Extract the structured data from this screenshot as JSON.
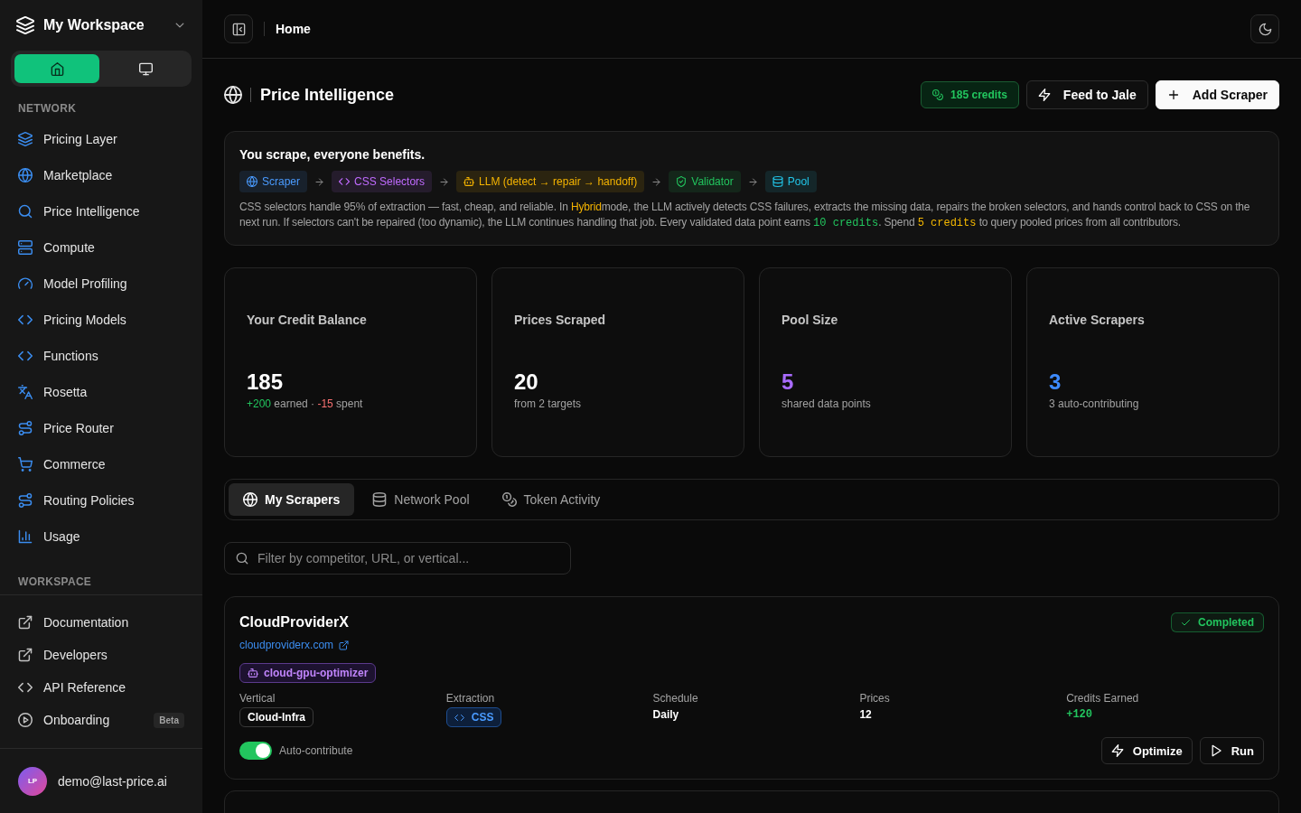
{
  "sidebar": {
    "workspace": {
      "name": "My Workspace"
    },
    "view_toggle": [
      {
        "selected": true
      },
      {
        "selected": false
      }
    ],
    "sections": [
      {
        "title": "NETWORK",
        "items": [
          {
            "label": "Pricing Layer"
          },
          {
            "label": "Marketplace"
          },
          {
            "label": "Price Intelligence"
          },
          {
            "label": "Compute"
          },
          {
            "label": "Model Profiling"
          },
          {
            "label": "Pricing Models"
          },
          {
            "label": "Functions"
          },
          {
            "label": "Rosetta"
          },
          {
            "label": "Price Router"
          },
          {
            "label": "Commerce"
          },
          {
            "label": "Routing Policies"
          },
          {
            "label": "Usage"
          }
        ]
      },
      {
        "title": "WORKSPACE",
        "items": [
          {
            "label": "Documentation"
          },
          {
            "label": "Developers"
          },
          {
            "label": "API Reference"
          },
          {
            "label": "Onboarding",
            "badge": "Beta"
          }
        ]
      }
    ],
    "user": {
      "initials": "LP",
      "email": "demo@last-price.ai"
    }
  },
  "header": {
    "breadcrumb": "Home"
  },
  "page": {
    "title": "Price Intelligence",
    "actions": [
      {
        "kind": "credits",
        "label": "185 credits"
      },
      {
        "kind": "secondary",
        "label": "Feed to Jale"
      },
      {
        "kind": "primary",
        "label": "Add Scraper"
      }
    ]
  },
  "pipeline_card": {
    "title": "You scrape, everyone benefits.",
    "steps": [
      {
        "label": "Scraper",
        "color": "#4a9bff"
      },
      {
        "label": "CSS Selectors",
        "color": "#c06bff"
      },
      {
        "label": "LLM (detect → repair → handoff)",
        "color": "#f5b400"
      },
      {
        "label": "Validator",
        "color": "#22c55e"
      },
      {
        "label": "Pool",
        "color": "#22c5e8"
      }
    ],
    "description": [
      {
        "kind": "text",
        "text": "CSS selectors handle 95% of extraction — fast, cheap, and reliable. In "
      },
      {
        "kind": "highlight",
        "text": "Hybrid",
        "color": "#f5b400"
      },
      {
        "kind": "text",
        "text": "mode, the LLM actively detects CSS failures, extracts the missing data, repairs the broken selectors, and hands control back to CSS on the next run. If selectors can't be repaired (too dynamic), the LLM continues handling that job. Every validated data point earns "
      },
      {
        "kind": "code",
        "text": "10 credits",
        "color": "#22c55e"
      },
      {
        "kind": "text",
        "text": ". Spend "
      },
      {
        "kind": "code",
        "text": "5 credits",
        "color": "#f5b800"
      },
      {
        "kind": "text",
        "text": " to query pooled prices from all contributors."
      }
    ]
  },
  "stats": [
    {
      "title": "Your Credit Balance",
      "value": "185",
      "color": "#ffffff",
      "caption": [
        {
          "text": "+200",
          "color": "#22c55e"
        },
        {
          "text": " earned · "
        },
        {
          "text": "-15",
          "color": "#f87171"
        },
        {
          "text": " spent"
        }
      ]
    },
    {
      "title": "Prices Scraped",
      "value": "20",
      "color": "#ffffff",
      "caption": [
        {
          "text": "from 2 targets"
        }
      ]
    },
    {
      "title": "Pool Size",
      "value": "5",
      "color": "#a96bff",
      "caption": [
        {
          "text": "shared data points"
        }
      ]
    },
    {
      "title": "Active Scrapers",
      "value": "3",
      "color": "#3d8bff",
      "caption": [
        {
          "text": "3 auto-contributing"
        }
      ]
    }
  ],
  "tabs": [
    {
      "label": "My Scrapers",
      "selected": true
    },
    {
      "label": "Network Pool",
      "selected": false
    },
    {
      "label": "Token Activity",
      "selected": false
    }
  ],
  "search": {
    "placeholder": "Filter by competitor, URL, or vertical..."
  },
  "scrapers": [
    {
      "name": "CloudProviderX",
      "url": "cloudproviderx.com",
      "agent": "cloud-gpu-optimizer",
      "status": {
        "label": "Completed",
        "color": "#22c55e"
      },
      "fields": [
        {
          "label": "Vertical",
          "value": "Cloud-Infra",
          "kind": "tag"
        },
        {
          "label": "Extraction",
          "value": "CSS",
          "kind": "method"
        },
        {
          "label": "Schedule",
          "value": "Daily",
          "kind": "text"
        },
        {
          "label": "Prices",
          "value": "12",
          "kind": "text"
        },
        {
          "label": "Credits Earned",
          "value": "+120",
          "kind": "credits"
        }
      ],
      "auto_contribute": {
        "label": "Auto-contribute",
        "on": true
      },
      "actions": [
        "Optimize",
        "Run"
      ]
    }
  ]
}
